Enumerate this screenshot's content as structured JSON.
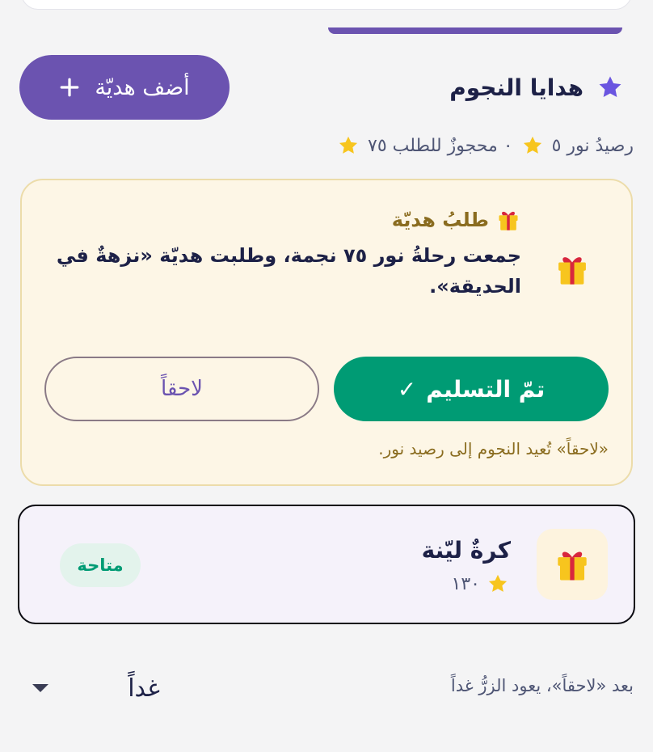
{
  "header": {
    "title": "هدايا النجوم",
    "add_label": "أضف هديّة"
  },
  "balance": {
    "line_balance": "رصيدُ نور ٥",
    "line_reserved": "٠ محجوزٌ للطلب ٧٥"
  },
  "request": {
    "title": "طلبُ هديّة",
    "message": "جمعت رحلةُ نور ٧٥ نجمة، وطلبت هديّة «نزهةٌ في الحديقة».",
    "delivered_label": "تمّ التسليم",
    "delivered_check": "✓",
    "later_label": "لاحقاً",
    "note": "«لاحقاً» تُعيد النجوم إلى رصيد نور."
  },
  "gift": {
    "name": "كرةٌ ليّنة",
    "cost": "١٣٠",
    "status": "متاحة"
  },
  "footer": {
    "note": "بعد «لاحقاً»، يعود الزرُّ غداً",
    "select_value": "غداً"
  },
  "colors": {
    "accent": "#6b53b0",
    "success": "#009b74",
    "star": "#f7c51e",
    "title_star": "#6a55e0"
  },
  "icons": {
    "title": "star-icon",
    "add": "plus-icon",
    "balance": "star-icon",
    "request": "gift-icon",
    "caret": "caret-down-icon"
  }
}
